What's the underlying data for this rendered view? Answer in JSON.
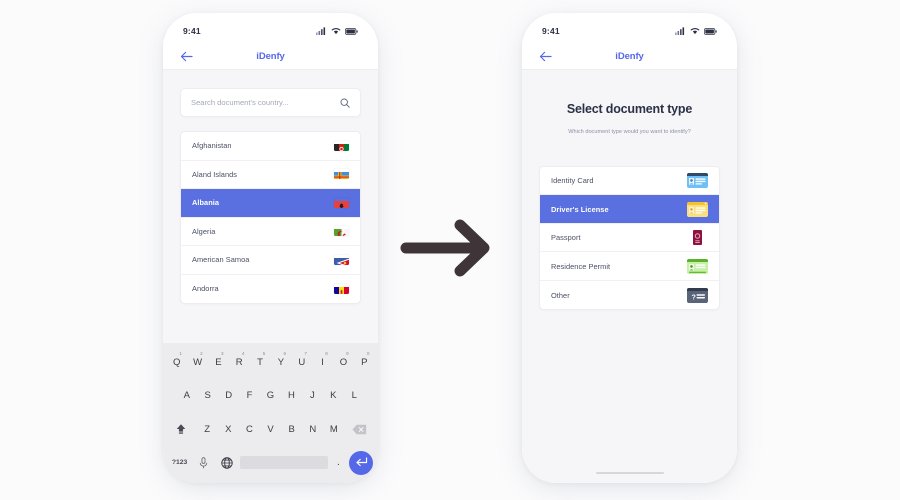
{
  "meta": {
    "accent_blue": "#5569e8",
    "selected_blue": "#5a6fe0",
    "arrow_color": "#3f3539",
    "page_background": "#fbfbfc",
    "screen_background": "#f6f6f8"
  },
  "arrow": {
    "name": "flow-arrow",
    "direction": "right"
  },
  "screen_left": {
    "status_bar": {
      "time": "9:41",
      "signal_icon": "signal-bars-icon",
      "wifi_icon": "wifi-icon",
      "battery_icon": "battery-icon"
    },
    "nav": {
      "back_icon": "back-arrow-icon",
      "brand": "iDenfy"
    },
    "search": {
      "value": "",
      "placeholder": "Search document's country...",
      "icon": "search-icon"
    },
    "countries": [
      {
        "label": "Afghanistan",
        "flag": "flag-afghanistan",
        "selected": false
      },
      {
        "label": "Aland Islands",
        "flag": "flag-aland-islands",
        "selected": false
      },
      {
        "label": "Albania",
        "flag": "flag-albania",
        "selected": true
      },
      {
        "label": "Algeria",
        "flag": "flag-algeria",
        "selected": false
      },
      {
        "label": "American Samoa",
        "flag": "flag-american-samoa",
        "selected": false
      },
      {
        "label": "Andorra",
        "flag": "flag-andorra",
        "selected": false
      }
    ],
    "keyboard": {
      "row1": [
        {
          "key": "Q",
          "num": "1"
        },
        {
          "key": "W",
          "num": "2"
        },
        {
          "key": "E",
          "num": "3"
        },
        {
          "key": "R",
          "num": "4"
        },
        {
          "key": "T",
          "num": "5"
        },
        {
          "key": "Y",
          "num": "6"
        },
        {
          "key": "U",
          "num": "7"
        },
        {
          "key": "I",
          "num": "8"
        },
        {
          "key": "O",
          "num": "9"
        },
        {
          "key": "P",
          "num": "0"
        }
      ],
      "row2": [
        "A",
        "S",
        "D",
        "F",
        "G",
        "H",
        "J",
        "K",
        "L"
      ],
      "row3": [
        "Z",
        "X",
        "C",
        "V",
        "B",
        "N",
        "M"
      ],
      "shift_icon": "shift-key-icon",
      "backspace_icon": "backspace-key-icon",
      "symbols_label": "?123",
      "mic_icon": "microphone-icon",
      "globe_icon": "globe-language-icon",
      "space_label": "",
      "period_label": ".",
      "enter_icon": "enter-key-icon"
    }
  },
  "screen_right": {
    "status_bar": {
      "time": "9:41",
      "signal_icon": "signal-bars-icon",
      "wifi_icon": "wifi-icon",
      "battery_icon": "battery-icon"
    },
    "nav": {
      "back_icon": "back-arrow-icon",
      "brand": "iDenfy"
    },
    "heading": "Select document type",
    "subheading": "Which document type would you want to identify?",
    "documents": [
      {
        "label": "Identity Card",
        "icon": "identity-card-icon",
        "selected": false
      },
      {
        "label": "Driver's License",
        "icon": "drivers-license-icon",
        "selected": true
      },
      {
        "label": "Passport",
        "icon": "passport-icon",
        "selected": false
      },
      {
        "label": "Residence Permit",
        "icon": "residence-permit-icon",
        "selected": false
      },
      {
        "label": "Other",
        "icon": "other-document-icon",
        "selected": false
      }
    ],
    "home_indicator": "home-indicator-bar"
  }
}
